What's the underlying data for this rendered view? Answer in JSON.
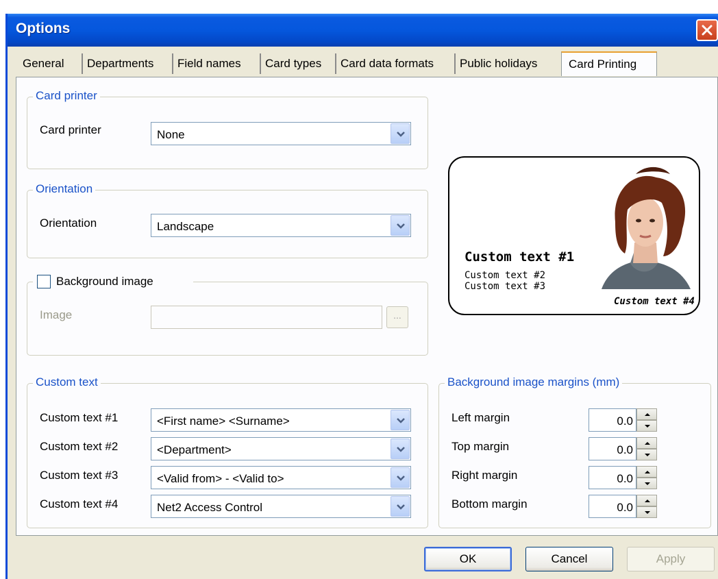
{
  "window": {
    "title": "Options"
  },
  "tabs": [
    {
      "label": "General"
    },
    {
      "label": "Departments"
    },
    {
      "label": "Field names"
    },
    {
      "label": "Card types"
    },
    {
      "label": "Card data formats"
    },
    {
      "label": "Public holidays"
    },
    {
      "label": "Card Printing"
    }
  ],
  "card_printer": {
    "group_title": "Card printer",
    "label": "Card printer",
    "value": "None"
  },
  "orientation": {
    "group_title": "Orientation",
    "label": "Orientation",
    "value": "Landscape"
  },
  "background_image": {
    "checkbox_label": "Background image",
    "checked": false,
    "image_label": "Image",
    "image_value": "",
    "browse_label": "..."
  },
  "custom_text": {
    "group_title": "Custom text",
    "rows": [
      {
        "label": "Custom text #1",
        "value": "<First name> <Surname>"
      },
      {
        "label": "Custom text #2",
        "value": "<Department>"
      },
      {
        "label": "Custom text #3",
        "value": "<Valid from> - <Valid to>"
      },
      {
        "label": "Custom text #4",
        "value": "Net2 Access Control"
      }
    ]
  },
  "margins": {
    "group_title": "Background image margins (mm)",
    "rows": [
      {
        "label": "Left margin",
        "value": "0.0"
      },
      {
        "label": "Top margin",
        "value": "0.0"
      },
      {
        "label": "Right margin",
        "value": "0.0"
      },
      {
        "label": "Bottom margin",
        "value": "0.0"
      }
    ]
  },
  "card_preview": {
    "text1": "Custom text #1",
    "text2": "Custom text #2",
    "text3": "Custom text #3",
    "text4": "Custom text #4"
  },
  "buttons": {
    "ok": "OK",
    "cancel": "Cancel",
    "apply": "Apply"
  },
  "colors": {
    "title_bar": "#0557dd",
    "dialog_bg": "#ece9d8",
    "group_title": "#1a52c8"
  }
}
